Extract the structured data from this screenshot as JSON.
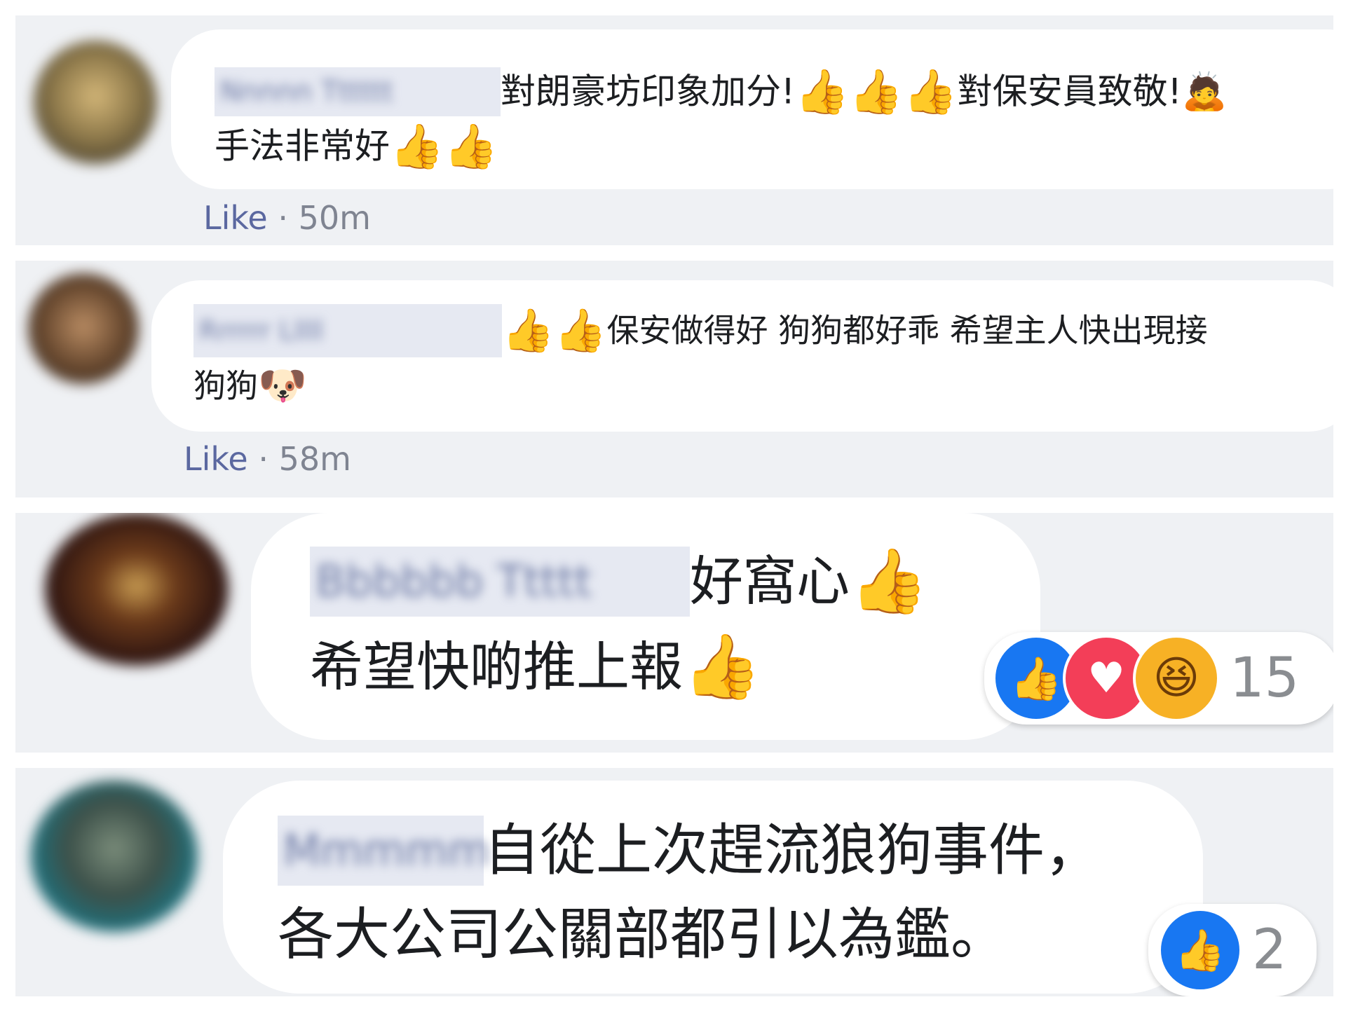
{
  "comments": [
    {
      "author_blurred": "Nnnnn Tttttt",
      "line1": "對朗豪坊印象加分!",
      "line1b": "對保安員致敬!",
      "line2": "手法非常好",
      "like_label": "Like",
      "separator": "·",
      "timestamp": "50m"
    },
    {
      "author_blurred": "Rrrrrr Lllll",
      "line1": "保安做得好 狗狗都好乖 希望主人快出現接",
      "line2": "狗狗",
      "like_label": "Like",
      "separator": "·",
      "timestamp": "58m"
    },
    {
      "author_blurred": "Bbbbbb Ttttt",
      "line1": "好窩心",
      "line2": "希望快啲推上報",
      "reaction_count": "15",
      "reactions": [
        "like-icon",
        "love-icon",
        "haha-icon"
      ]
    },
    {
      "author_blurred": "Mmmmm",
      "line1": "自從上次趕流狼狗事件，",
      "line2": "各大公司公關部都引以為鑑。",
      "reaction_count": "2",
      "reactions": [
        "like-icon"
      ]
    }
  ],
  "icons": {
    "thumbs_up": "thumbs-up-emoji",
    "dog": "dog-face-emoji",
    "bow": "person-bowing-emoji"
  },
  "colors": {
    "panel_bg": "#eff1f4",
    "like_blue": "#1877f2",
    "love_red": "#f33e58",
    "haha_yellow": "#f7b125",
    "meta_like": "#5b68a0"
  }
}
